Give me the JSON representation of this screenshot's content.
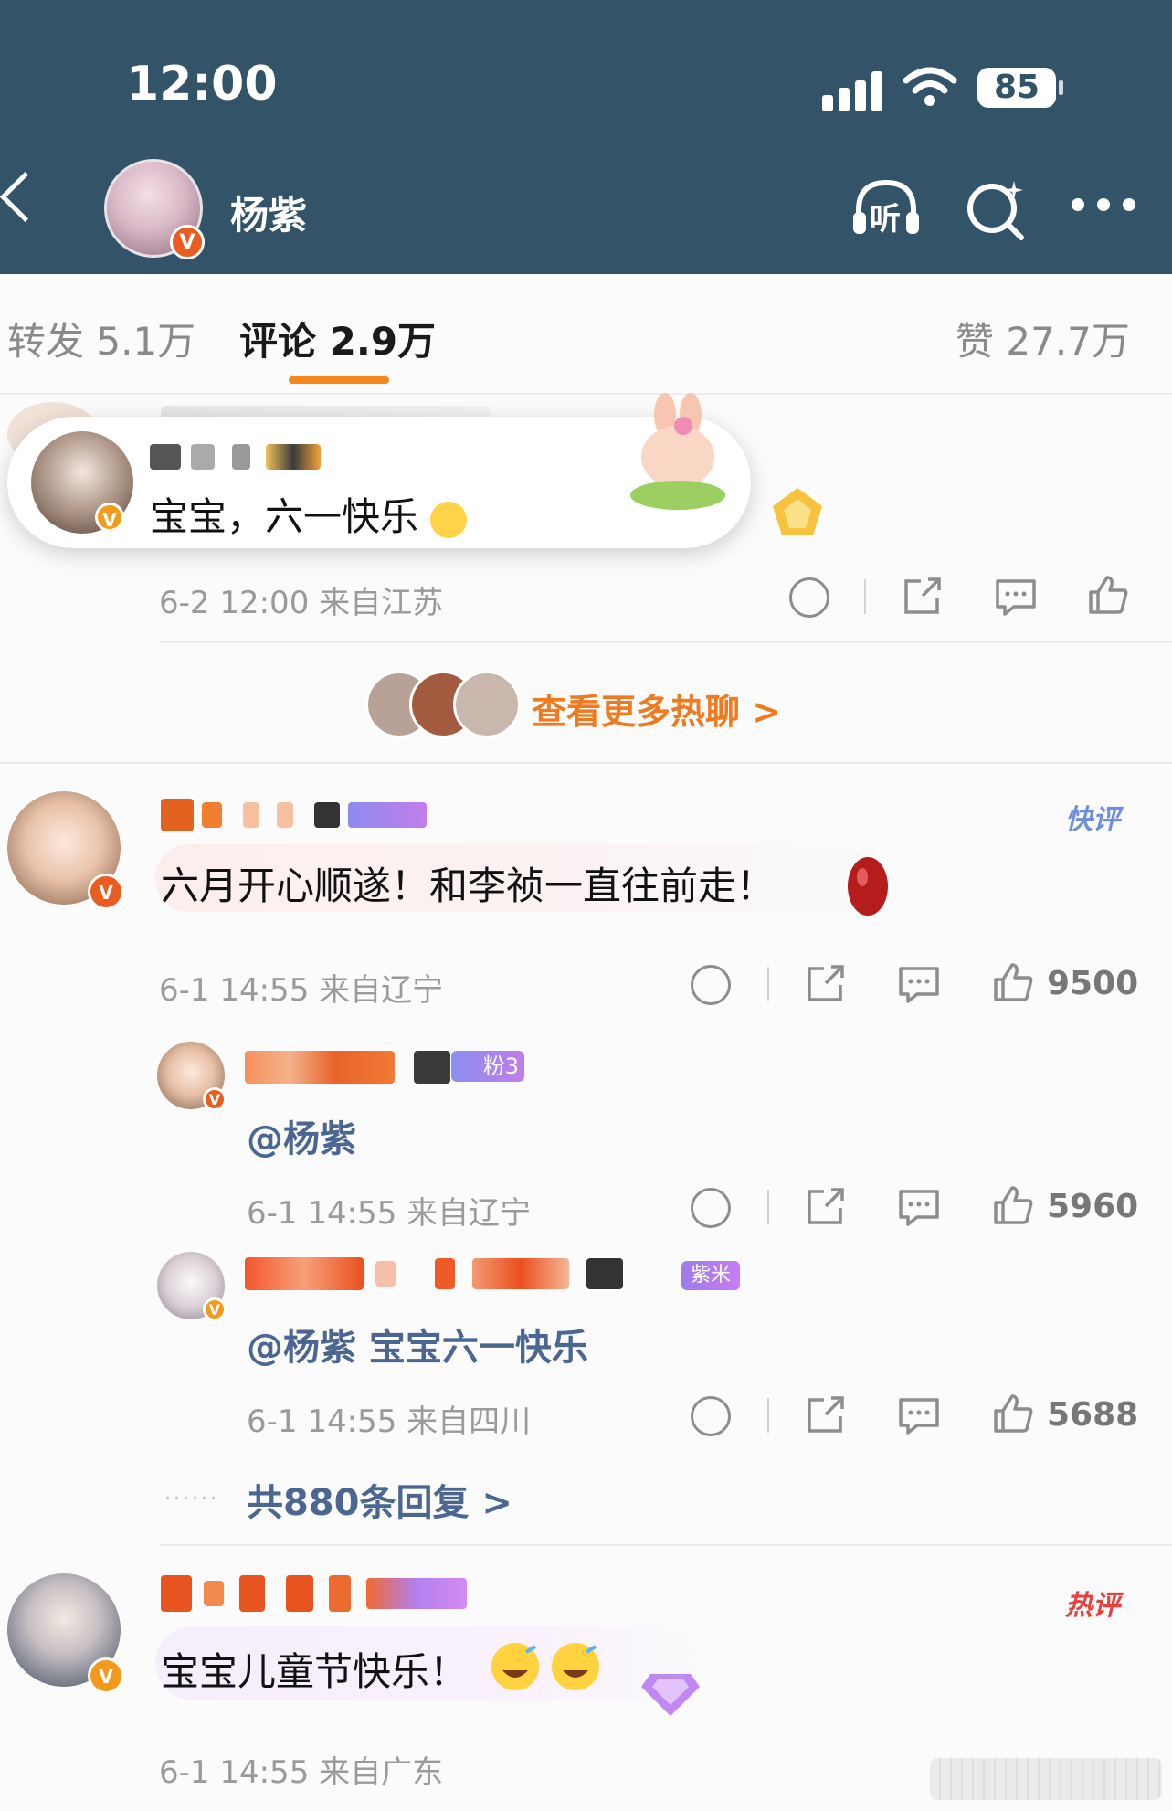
{
  "status_bar": {
    "time": "12:00",
    "battery": "85"
  },
  "header": {
    "title": "杨紫",
    "listen_label": "听"
  },
  "tabs": [
    {
      "label": "转发",
      "count": "5.1万"
    },
    {
      "label": "评论",
      "count": "2.9万"
    },
    {
      "label": "赞",
      "count": "27.7万"
    }
  ],
  "popup_reply": {
    "text": "宝宝，六一快乐"
  },
  "first_comment": {
    "meta": "6-2 12:00 来自江苏"
  },
  "more_hot": {
    "label": "查看更多热聊 >"
  },
  "comments": [
    {
      "badge": "快评",
      "text": "六月开心顺遂！和李祯一直往前走！",
      "meta": "6-1 14:55 来自辽宁",
      "likes": "9500"
    },
    {
      "badge": "热评",
      "text": "宝宝儿童节快乐！",
      "meta": "6-1 14:55 来自广东"
    }
  ],
  "replies": [
    {
      "level_tag": "粉3",
      "text": "@杨紫",
      "meta": "6-1 14:55 来自辽宁",
      "likes": "5960"
    },
    {
      "level_tag": "紫米",
      "text": "@杨紫 宝宝六一快乐",
      "meta": "6-1 14:55 来自四川",
      "likes": "5688"
    }
  ],
  "total_replies": {
    "label": "共880条回复 >"
  },
  "colors": {
    "header": "#335368",
    "accent": "#f6861d",
    "link": "#4b6791"
  },
  "icons": [
    "back-icon",
    "headphone-icon",
    "search-icon",
    "more-icon",
    "dislike-icon",
    "share-icon",
    "comment-icon",
    "like-icon"
  ]
}
